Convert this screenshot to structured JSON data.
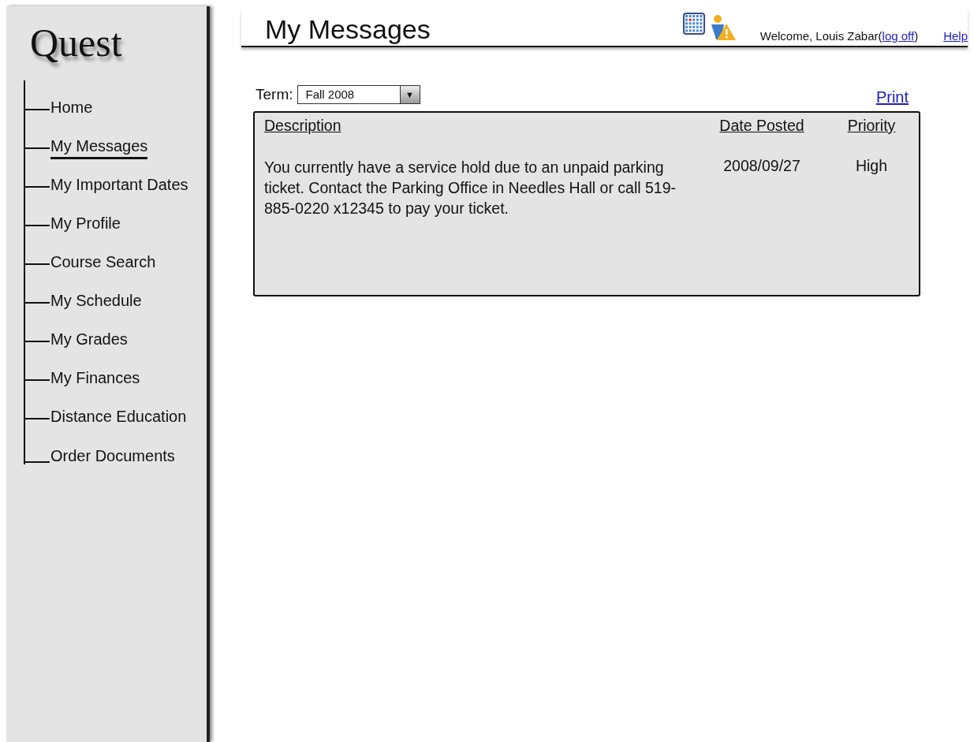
{
  "logo": "Quest",
  "nav": [
    {
      "label": "Home",
      "selected": false
    },
    {
      "label": "My Messages",
      "selected": true
    },
    {
      "label": "My Important Dates",
      "selected": false
    },
    {
      "label": "My Profile",
      "selected": false
    },
    {
      "label": "Course Search",
      "selected": false
    },
    {
      "label": "My Schedule",
      "selected": false
    },
    {
      "label": "My Grades",
      "selected": false
    },
    {
      "label": "My Finances",
      "selected": false
    },
    {
      "label": "Distance Education",
      "selected": false
    },
    {
      "label": "Order Documents",
      "selected": false
    }
  ],
  "header": {
    "title": "My Messages",
    "welcome": "Welcome, Louis Zabar",
    "open_paren": "(",
    "logoff": "log off",
    "close_paren": ")",
    "help": "Help"
  },
  "term": {
    "label": "Term:",
    "value": "Fall 2008",
    "arrow": "▼"
  },
  "print": "Print",
  "table": {
    "columns": [
      "Description",
      "Date Posted",
      "Priority"
    ],
    "rows": [
      {
        "description": "You currently have a service hold due to an unpaid parking ticket.  Contact the Parking Office in Needles Hall or call 519-885-0220 x12345 to pay your ticket.",
        "date": "2008/09/27",
        "priority": "High"
      }
    ]
  }
}
